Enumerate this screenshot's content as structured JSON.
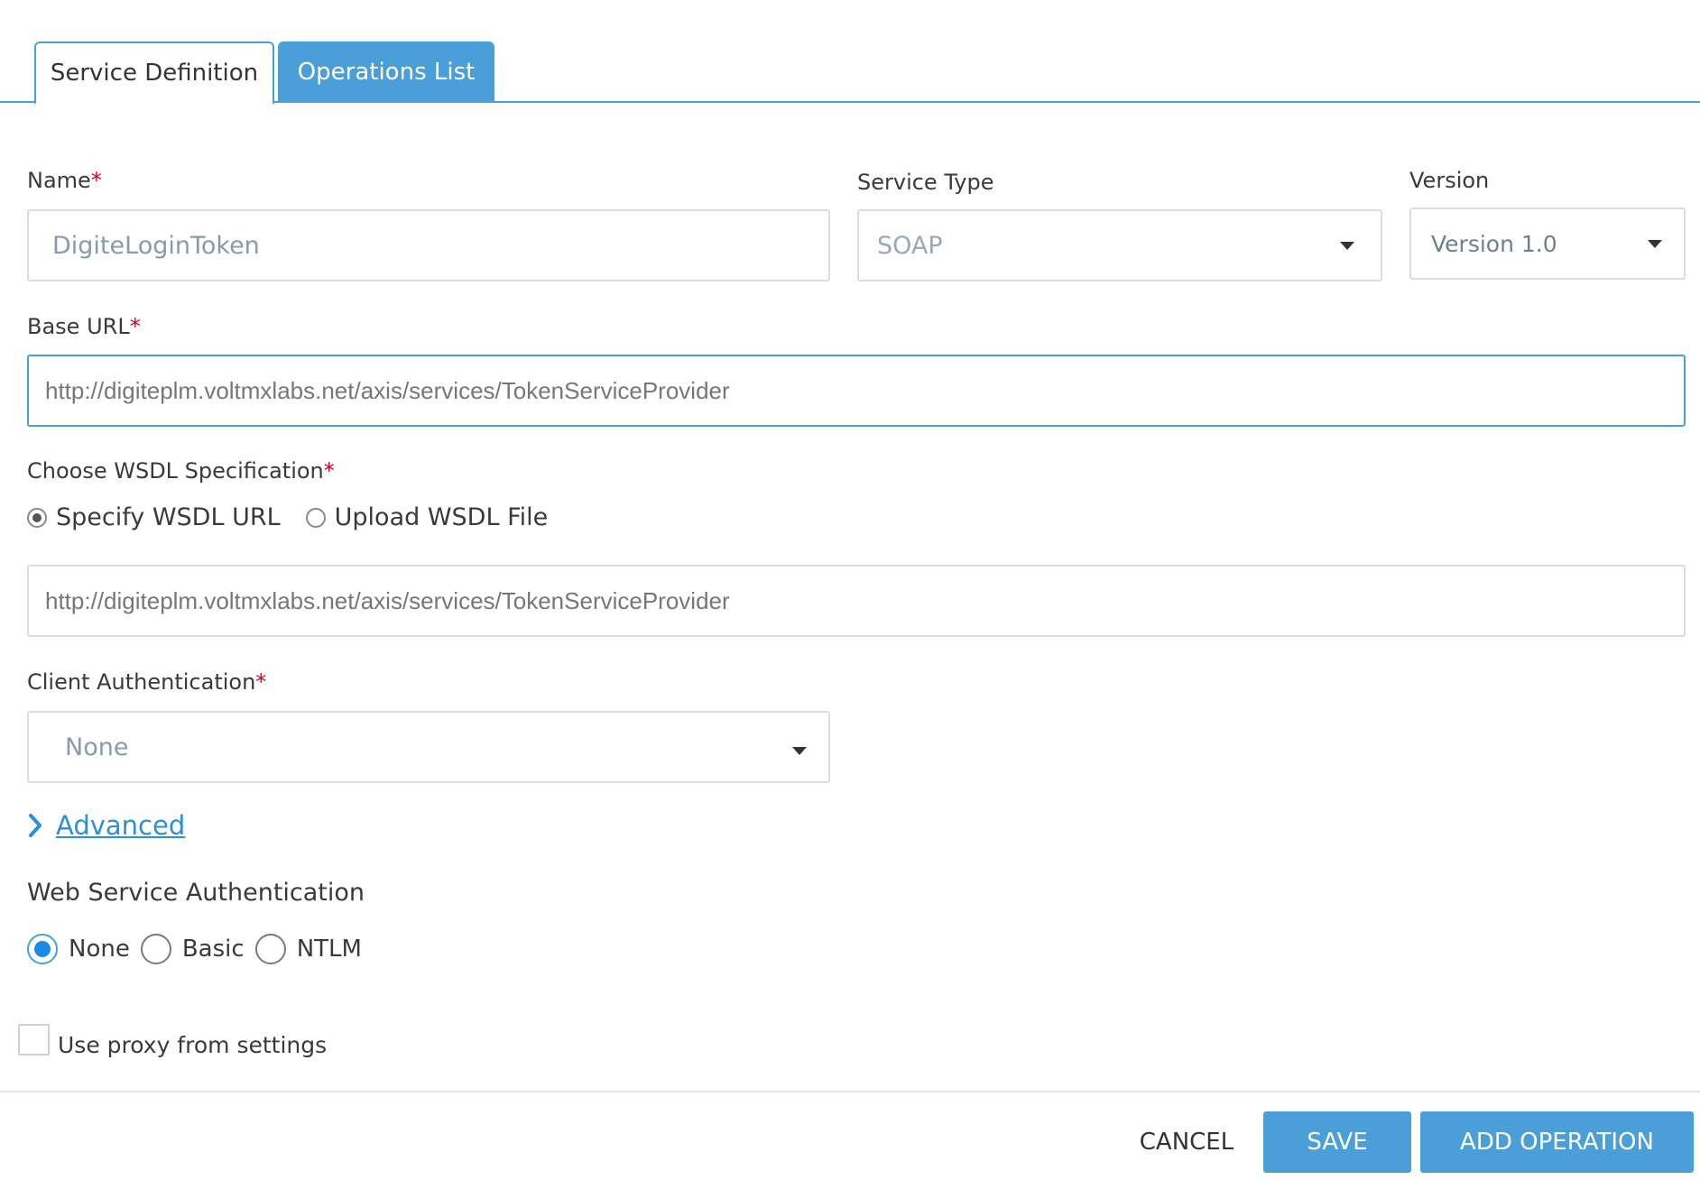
{
  "tabs": {
    "service_definition": "Service Definition",
    "operations_list": "Operations List"
  },
  "form": {
    "name": {
      "label": "Name",
      "required": "*",
      "value": "DigiteLoginToken"
    },
    "service_type": {
      "label": "Service Type",
      "value": "SOAP"
    },
    "version": {
      "label": "Version",
      "value": "Version 1.0"
    },
    "base_url": {
      "label": "Base URL",
      "required": "*",
      "value": "http://digiteplm.voltmxlabs.net/axis/services/TokenServiceProvider"
    },
    "wsdl": {
      "label": "Choose WSDL Specification",
      "required": "*",
      "option_url": "Specify WSDL URL",
      "option_file": "Upload WSDL File",
      "selected": "Specify WSDL URL",
      "url_value": "http://digiteplm.voltmxlabs.net/axis/services/TokenServiceProvider"
    },
    "client_auth": {
      "label": "Client Authentication",
      "required": "*",
      "value": "None"
    },
    "advanced": {
      "label": "Advanced"
    },
    "web_service_auth": {
      "label": "Web Service Authentication",
      "options": [
        "None",
        "Basic",
        "NTLM"
      ],
      "selected": "None"
    },
    "proxy": {
      "label": "Use proxy from settings",
      "checked": false
    }
  },
  "footer": {
    "cancel": "CANCEL",
    "save": "SAVE",
    "add_operation": "ADD OPERATION"
  },
  "colors": {
    "accent": "#4a9fd8",
    "required": "#d0021b",
    "link": "#2d8fd5"
  }
}
